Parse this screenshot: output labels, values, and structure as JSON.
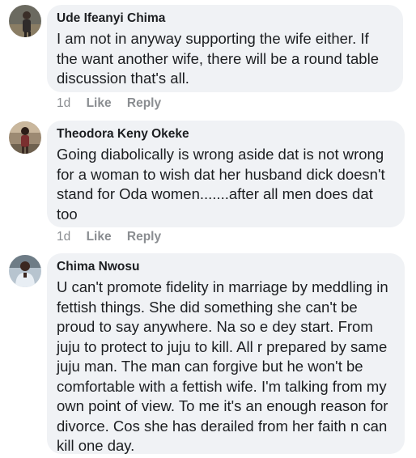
{
  "comments": [
    {
      "author": "Ude Ifeanyi Chima",
      "text": "I am not in anyway supporting the wife either. If the want another wife, there will be a round table discussion that's all.",
      "time": "1d",
      "like": "Like",
      "reply": "Reply"
    },
    {
      "author": "Theodora Keny Okeke",
      "text": "Going diabolically is wrong aside dat  is not wrong for a woman to wish dat her husband dick doesn't stand for Oda women.......after all men does dat too",
      "time": "1d",
      "like": "Like",
      "reply": "Reply"
    },
    {
      "author": "Chima Nwosu",
      "text": "U can't promote fidelity in marriage by meddling in fettish things. She did something she can't be proud to say anywhere. Na so e dey start. From juju to protect to juju to kill. All r prepared by same juju man. The man can forgive but he won't be comfortable with a fettish wife. I'm talking from my own point of view. To me it's an enough reason for divorce. Cos she has derailed from her faith n can kill one day."
    }
  ]
}
